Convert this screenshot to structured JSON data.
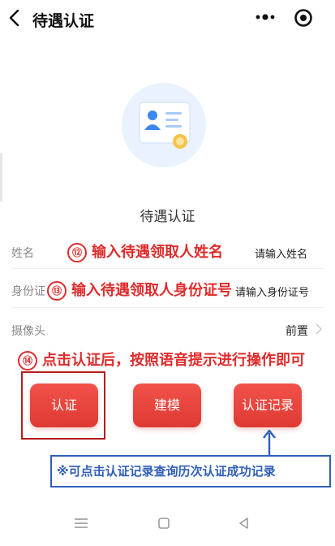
{
  "header": {
    "title": "待遇认证",
    "back_icon": "chevron-left-icon",
    "more_icon": "more-dots-icon",
    "target_icon": "target-icon"
  },
  "main": {
    "heading": "待遇认证",
    "illustration_icon": "id-card-icon",
    "rows": {
      "name": {
        "label": "姓名",
        "placeholder": "请输入姓名",
        "step": "⑫",
        "annotation": "输入待遇领取人姓名"
      },
      "id": {
        "label": "身份证",
        "placeholder": "请输入身份证号",
        "step": "⑬",
        "annotation": "输入待遇领取人身份证号"
      },
      "camera": {
        "label": "摄像头",
        "value": "前置"
      }
    },
    "step14": {
      "step": "⑭",
      "annotation": "点击认证后，按照语音提示进行操作即可"
    },
    "buttons": {
      "verify": "认证",
      "model": "建模",
      "records": "认证记录"
    },
    "note": "※可点击认证记录查询历次认证成功记录"
  },
  "nav": {
    "menu_icon": "menu-icon",
    "home_icon": "square-home-icon",
    "back_icon": "triangle-back-icon"
  },
  "colors": {
    "accent": "#e02b2b",
    "button": "#ea463f",
    "note": "#2f5fb8"
  }
}
